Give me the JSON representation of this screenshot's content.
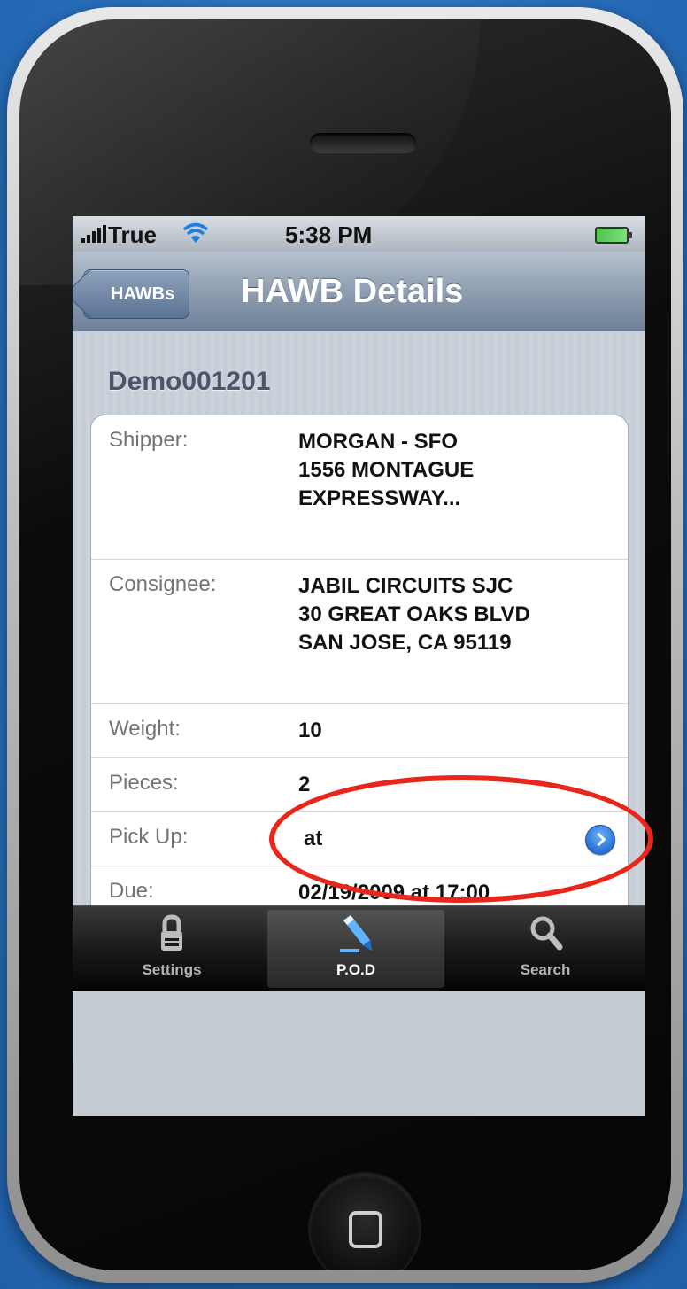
{
  "status_bar": {
    "carrier": "True",
    "time": "5:38 PM"
  },
  "nav": {
    "back_label": "HAWBs",
    "title": "HAWB Details"
  },
  "record": {
    "id": "Demo001201",
    "fields": [
      {
        "label": "Shipper:",
        "lines": [
          "MORGAN - SFO",
          "1556 MONTAGUE",
          "EXPRESSWAY..."
        ]
      },
      {
        "label": "Consignee:",
        "lines": [
          "JABIL CIRCUITS SJC",
          "30 GREAT OAKS BLVD",
          "SAN JOSE, CA 95119"
        ]
      },
      {
        "label": "Weight:",
        "value": "10"
      },
      {
        "label": "Pieces:",
        "value": "2"
      },
      {
        "label": "Pick Up:",
        "value": "at"
      },
      {
        "label": "Due:",
        "value": "02/19/2009 at 17:00"
      }
    ]
  },
  "tabs": [
    {
      "label": "Settings",
      "icon": "lock-icon"
    },
    {
      "label": "P.O.D",
      "icon": "pen-icon",
      "selected": true
    },
    {
      "label": "Search",
      "icon": "magnifier-icon"
    }
  ],
  "colors": {
    "annotation": "#e8271c",
    "disclosure": "#2771d8"
  }
}
